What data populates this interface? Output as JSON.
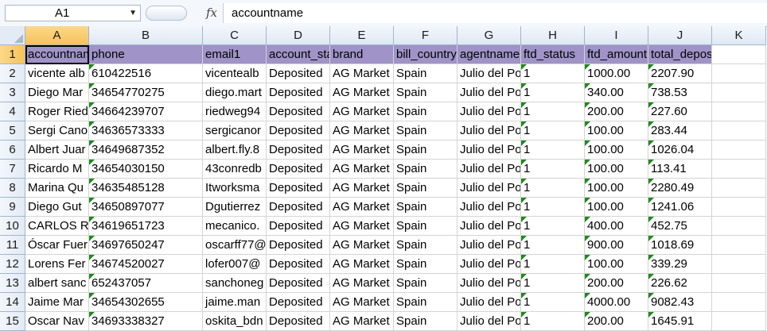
{
  "formula_bar": {
    "name_box": "A1",
    "fx_label": "fx",
    "formula": "accountname"
  },
  "grid": {
    "columns": [
      "A",
      "B",
      "C",
      "D",
      "E",
      "F",
      "G",
      "H",
      "I",
      "J",
      "K"
    ],
    "rows": [
      {
        "num": "1",
        "cells": [
          "accountname",
          "phone",
          "email1",
          "account_status",
          "brand",
          "bill_country",
          "agentname",
          "ftd_status",
          "ftd_amount",
          "total_deposited_usd",
          ""
        ]
      },
      {
        "num": "2",
        "cells": [
          "vicente alb",
          "610422516",
          "vicentealb",
          "Deposited",
          "AG Market",
          "Spain",
          "Julio del Po",
          "1",
          "1000.00",
          "2207.90",
          ""
        ]
      },
      {
        "num": "3",
        "cells": [
          "Diego Mar",
          "34654770275",
          "diego.mart",
          "Deposited",
          "AG Market",
          "Spain",
          "Julio del Po",
          "1",
          "340.00",
          "738.53",
          ""
        ]
      },
      {
        "num": "4",
        "cells": [
          "Roger Ried",
          "34664239707",
          "riedweg94",
          "Deposited",
          "AG Market",
          "Spain",
          "Julio del Po",
          "1",
          "200.00",
          "227.60",
          ""
        ]
      },
      {
        "num": "5",
        "cells": [
          "Sergi Cano",
          "34636573333",
          "sergicanor",
          "Deposited",
          "AG Market",
          "Spain",
          "Julio del Po",
          "1",
          "100.00",
          "283.44",
          ""
        ]
      },
      {
        "num": "6",
        "cells": [
          "Albert Juar",
          "34649687352",
          "albert.fly.8",
          "Deposited",
          "AG Market",
          "Spain",
          "Julio del Po",
          "1",
          "100.00",
          "1026.04",
          ""
        ]
      },
      {
        "num": "7",
        "cells": [
          "Ricardo M",
          "34654030150",
          "43conredb",
          "Deposited",
          "AG Market",
          "Spain",
          "Julio del Po",
          "1",
          "100.00",
          "113.41",
          ""
        ]
      },
      {
        "num": "8",
        "cells": [
          "Marina Qu",
          "34635485128",
          "Itworksma",
          "Deposited",
          "AG Market",
          "Spain",
          "Julio del Po",
          "1",
          "100.00",
          "2280.49",
          ""
        ]
      },
      {
        "num": "9",
        "cells": [
          "Diego  Gut",
          "34650897077",
          "Dgutierrez",
          "Deposited",
          "AG Market",
          "Spain",
          "Julio del Po",
          "1",
          "100.00",
          "1241.06",
          ""
        ]
      },
      {
        "num": "10",
        "cells": [
          "CARLOS RO",
          "34619651723",
          "mecanico.",
          "Deposited",
          "AG Market",
          "Spain",
          "Julio del Po",
          "1",
          "400.00",
          "452.75",
          ""
        ]
      },
      {
        "num": "11",
        "cells": [
          "Óscar Fuer",
          "34697650247",
          "oscarff77@",
          "Deposited",
          "AG Market",
          "Spain",
          "Julio del Po",
          "1",
          "900.00",
          "1018.69",
          ""
        ]
      },
      {
        "num": "12",
        "cells": [
          "Lorens Fer",
          "34674520027",
          "lofer007@",
          "Deposited",
          "AG Market",
          "Spain",
          "Julio del Po",
          "1",
          "100.00",
          "339.29",
          ""
        ]
      },
      {
        "num": "13",
        "cells": [
          "albert sanc",
          "652437057",
          "sanchoneg",
          "Deposited",
          "AG Market",
          "Spain",
          "Julio del Po",
          "1",
          "200.00",
          "226.62",
          ""
        ]
      },
      {
        "num": "14",
        "cells": [
          "Jaime Mar",
          "34654302655",
          "jaime.man",
          "Deposited",
          "AG Market",
          "Spain",
          "Julio del Po",
          "1",
          "4000.00",
          "9082.43",
          ""
        ]
      },
      {
        "num": "15",
        "cells": [
          "Oscar Nav",
          "34693338327",
          "oskita_bdn",
          "Deposited",
          "AG Market",
          "Spain",
          "Julio del Po",
          "1",
          "200.00",
          "1645.91",
          ""
        ]
      }
    ]
  },
  "colors": {
    "header_row_fill": "#9f93c8",
    "selected_header": "#f7c25a",
    "number_as_text_marker": "#1e8a1e"
  }
}
